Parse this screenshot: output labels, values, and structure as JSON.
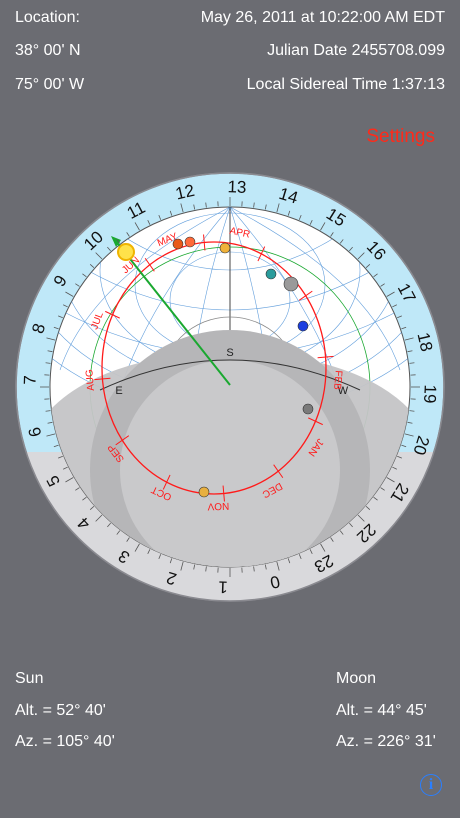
{
  "header": {
    "location_label": "Location:",
    "datetime": "May 26, 2011 at 10:22:00 AM EDT",
    "latitude": "38° 00' N",
    "julian_date": "Julian Date 2455708.099",
    "longitude": "75° 00' W",
    "sidereal_time": "Local Sidereal Time 1:37:13"
  },
  "settings_label": "Settings",
  "astrolabe": {
    "hour_labels": [
      "13",
      "14",
      "15",
      "16",
      "17",
      "18",
      "19",
      "20",
      "21",
      "22",
      "23",
      "0",
      "1",
      "2",
      "3",
      "4",
      "5",
      "6",
      "7",
      "8",
      "9",
      "10",
      "11",
      "12"
    ],
    "month_labels": [
      "MAY",
      "APR",
      "FEB",
      "JAN",
      "DEC",
      "NOV",
      "OCT",
      "SEP",
      "AUG",
      "JUL",
      "JUN"
    ],
    "horizon_labels": {
      "south": "S",
      "east": "E",
      "west": "W"
    },
    "colors": {
      "ring": "#bfe8f8",
      "ecliptic": "#ff1a1a",
      "grid": "#2f7fd0",
      "sun_pointer": "#1aa830"
    }
  },
  "sun": {
    "title": "Sun",
    "alt": "Alt. = 52° 40'",
    "az": "Az. = 105° 40'"
  },
  "moon": {
    "title": "Moon",
    "alt": "Alt. = 44° 45'",
    "az": "Az. = 226° 31'"
  },
  "info_icon": "i"
}
